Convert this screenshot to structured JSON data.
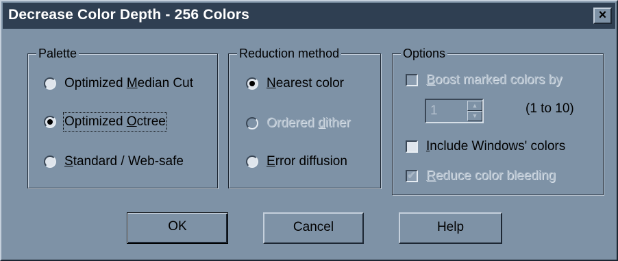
{
  "window": {
    "title": "Decrease Color Depth - 256 Colors",
    "close_label": "×"
  },
  "palette": {
    "legend": "Palette",
    "options": [
      {
        "pre": "Optimized ",
        "u": "M",
        "post": "edian Cut",
        "selected": false
      },
      {
        "pre": "Optimized ",
        "u": "O",
        "post": "ctree",
        "selected": true
      },
      {
        "pre": "",
        "u": "S",
        "post": "tandard / Web-safe",
        "selected": false
      }
    ]
  },
  "reduction": {
    "legend": "Reduction method",
    "options": [
      {
        "pre": "",
        "u": "N",
        "post": "earest color",
        "selected": true,
        "disabled": false
      },
      {
        "pre": "Ordered ",
        "u": "d",
        "post": "ither",
        "selected": false,
        "disabled": true
      },
      {
        "pre": "",
        "u": "E",
        "post": "rror diffusion",
        "selected": false,
        "disabled": false
      }
    ]
  },
  "options": {
    "legend": "Options",
    "boost": {
      "pre": "",
      "u": "B",
      "post": "oost marked colors by",
      "checked": false,
      "disabled": true
    },
    "boost_value": "1",
    "boost_range": "(1 to 10)",
    "include_windows": {
      "pre": "",
      "u": "I",
      "post": "nclude Windows' colors",
      "checked": false,
      "disabled": false
    },
    "reduce_bleeding": {
      "pre": "",
      "u": "R",
      "post": "educe color bleeding",
      "checked": true,
      "disabled": true
    }
  },
  "buttons": {
    "ok": "OK",
    "cancel": "Cancel",
    "help": "Help"
  },
  "colors": {
    "face": "#7e92a6",
    "title_bar": "#2f3f52",
    "highlight": "#c5d0dc",
    "shadow": "#1d2733"
  }
}
